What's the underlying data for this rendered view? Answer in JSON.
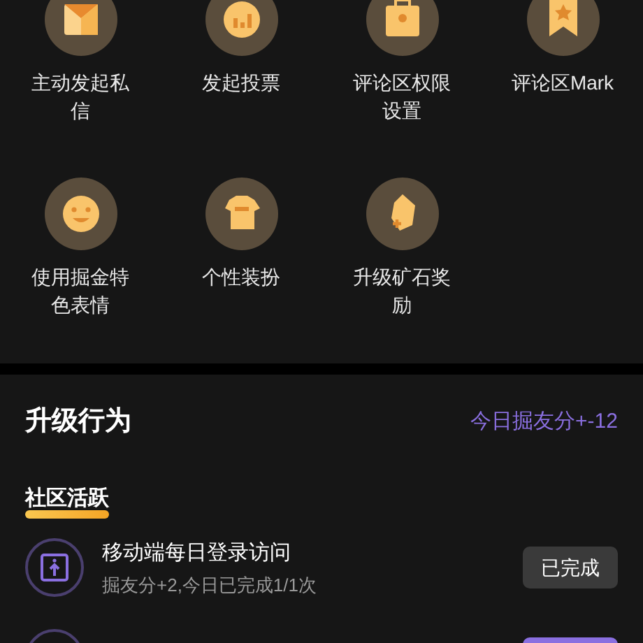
{
  "privileges": [
    {
      "label": "主动发起私信"
    },
    {
      "label": "发起投票"
    },
    {
      "label": "评论区权限设置"
    },
    {
      "label": "评论区Mark"
    },
    {
      "label": "使用掘金特色表情"
    },
    {
      "label": "个性装扮"
    },
    {
      "label": "升级矿石奖励"
    }
  ],
  "upgrade": {
    "title": "升级行为",
    "today": "今日掘友分+-12",
    "section": "社区活跃",
    "tasks": [
      {
        "title": "移动端每日登录访问",
        "detail": "掘友分+2,今日已完成1/1次",
        "button": "已完成",
        "done": true
      },
      {
        "done": false
      }
    ]
  }
}
